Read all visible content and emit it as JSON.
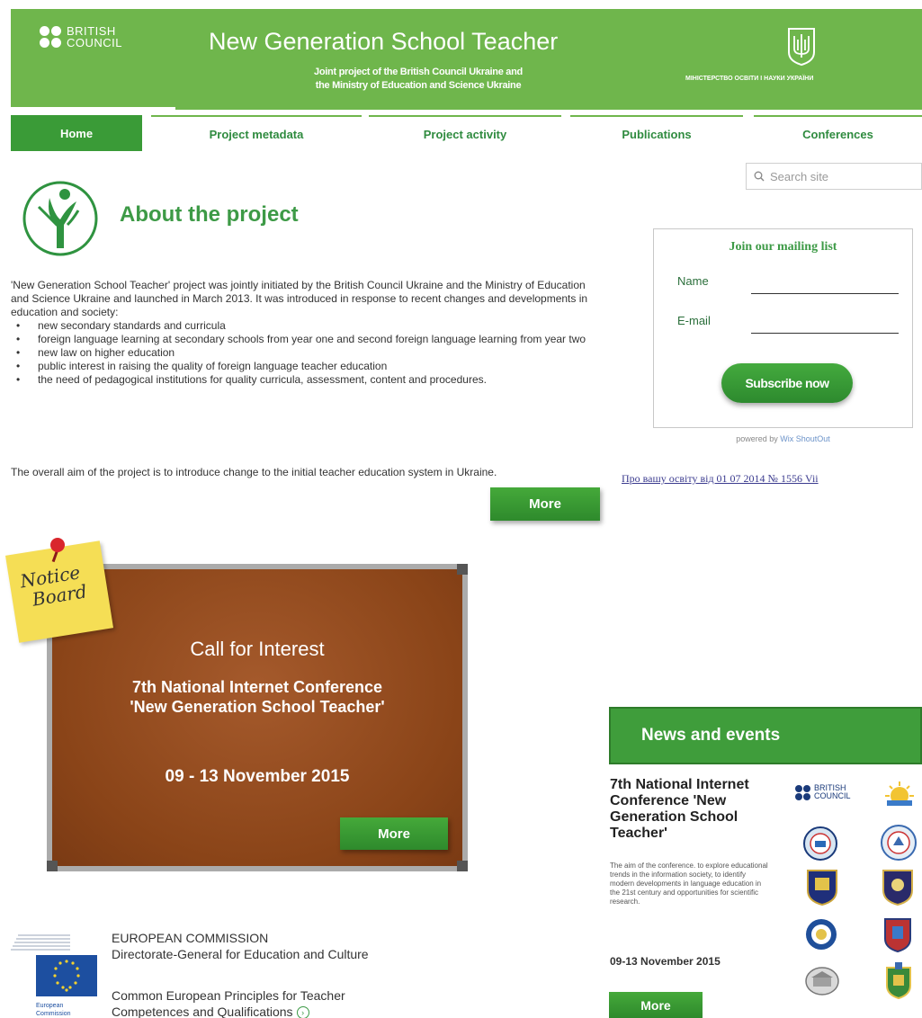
{
  "header": {
    "org_logo_line1": "BRITISH",
    "org_logo_line2": "COUNCIL",
    "title": "New Generation School Teacher",
    "subtitle_line1": "Joint project of the British Council Ukraine and",
    "subtitle_line2": "the Ministry of Education and Science Ukraine",
    "ministry_name": "МІНІСТЕРСТВО ОСВІТИ І НАУКИ УКРАЇНИ"
  },
  "nav": {
    "items": [
      {
        "label": "Home",
        "active": true
      },
      {
        "label": "Project metadata",
        "active": false
      },
      {
        "label": "Project activity",
        "active": false
      },
      {
        "label": "Publications",
        "active": false
      },
      {
        "label": "Conferences",
        "active": false
      }
    ]
  },
  "search": {
    "placeholder": "Search site",
    "icon": "search-icon"
  },
  "about": {
    "title": "About the project",
    "intro": "'New Generation School Teacher' project was jointly initiated by the British Council Ukraine and the Ministry of Education and Science Ukraine and launched in March 2013. It was introduced in response to recent changes and developments in education and society:",
    "bullets": [
      "new secondary standards and curricula",
      "foreign language learning at secondary schools from year one and second foreign language learning from year two",
      "new law on higher education",
      "public interest in raising the quality of foreign language teacher education",
      "the need of pedagogical institutions for quality curricula, assessment, content and procedures."
    ],
    "aim": "The overall aim of the project is to introduce change to the initial teacher education system in Ukraine.",
    "more_label": "More"
  },
  "mailing": {
    "title": "Join our mailing list",
    "name_label": "Name",
    "email_label": "E-mail",
    "name_value": "",
    "email_value": "",
    "subscribe_label": "Subscribe now",
    "powered_prefix": "powered by",
    "powered_brand": "Wix ShoutOut"
  },
  "ua_link": "Про вашу освіту від 01 07 2014 № 1556 Vii",
  "notice": {
    "sticky_line1": "Notice",
    "sticky_line2": "Board",
    "call_title": "Call for Interest",
    "conf_line1": "7th National Internet Conference",
    "conf_line2": "'New Generation School Teacher'",
    "dates": "09 - 13 November 2015",
    "more_label": "More"
  },
  "news": {
    "header": "News and events",
    "item_title": "7th National Internet Conference 'New Generation School Teacher'",
    "item_text": "The aim of the conference. to explore educational trends in the information society, to identify modern developments in language education in the 21st century and opportunities for scientific research.",
    "item_date": "09-13 November 2015",
    "more_label": "More"
  },
  "partners": {
    "bc_line1": "BRITISH",
    "bc_line2": "COUNCIL"
  },
  "ec": {
    "logo_caption_line1": "European",
    "logo_caption_line2": "Commission",
    "org_line1": "EUROPEAN COMMISSION",
    "org_line2": "Directorate-General for Education and Culture",
    "doc_line1": "Common European Principles for Teacher",
    "doc_line2": "Competences and Qualifications"
  },
  "colors": {
    "brand_green": "#6fb64c",
    "dark_green": "#3a9b37",
    "title_green": "#3d9a46",
    "cork": "#8a4418"
  }
}
